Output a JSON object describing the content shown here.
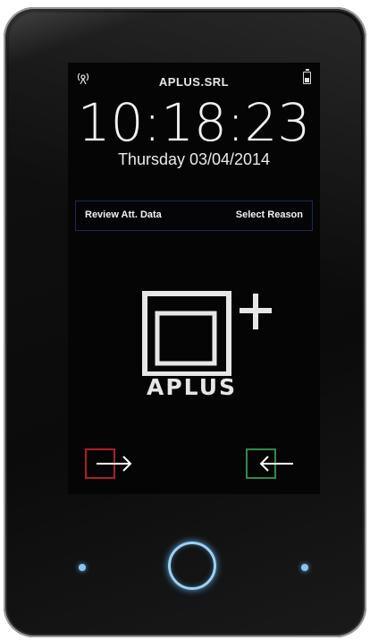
{
  "status": {
    "title": "APLUS.SRL",
    "left_icon": "signal-antenna-icon",
    "right_icon": "battery-charging-icon",
    "battery_level": 0.6
  },
  "clock": {
    "time": "10:18:23",
    "date": "Thursday 03/04/2014"
  },
  "actions": {
    "review_label": "Review Att. Data",
    "reason_label": "Select Reason"
  },
  "logo": {
    "text": "APLUS"
  },
  "punch": {
    "in_icon": "clock-in-arrow-icon",
    "out_icon": "clock-out-arrow-icon",
    "in_color": "#b01e23",
    "out_color": "#2e8a4c"
  },
  "colors": {
    "accent_blue": "#9fd0f2"
  }
}
